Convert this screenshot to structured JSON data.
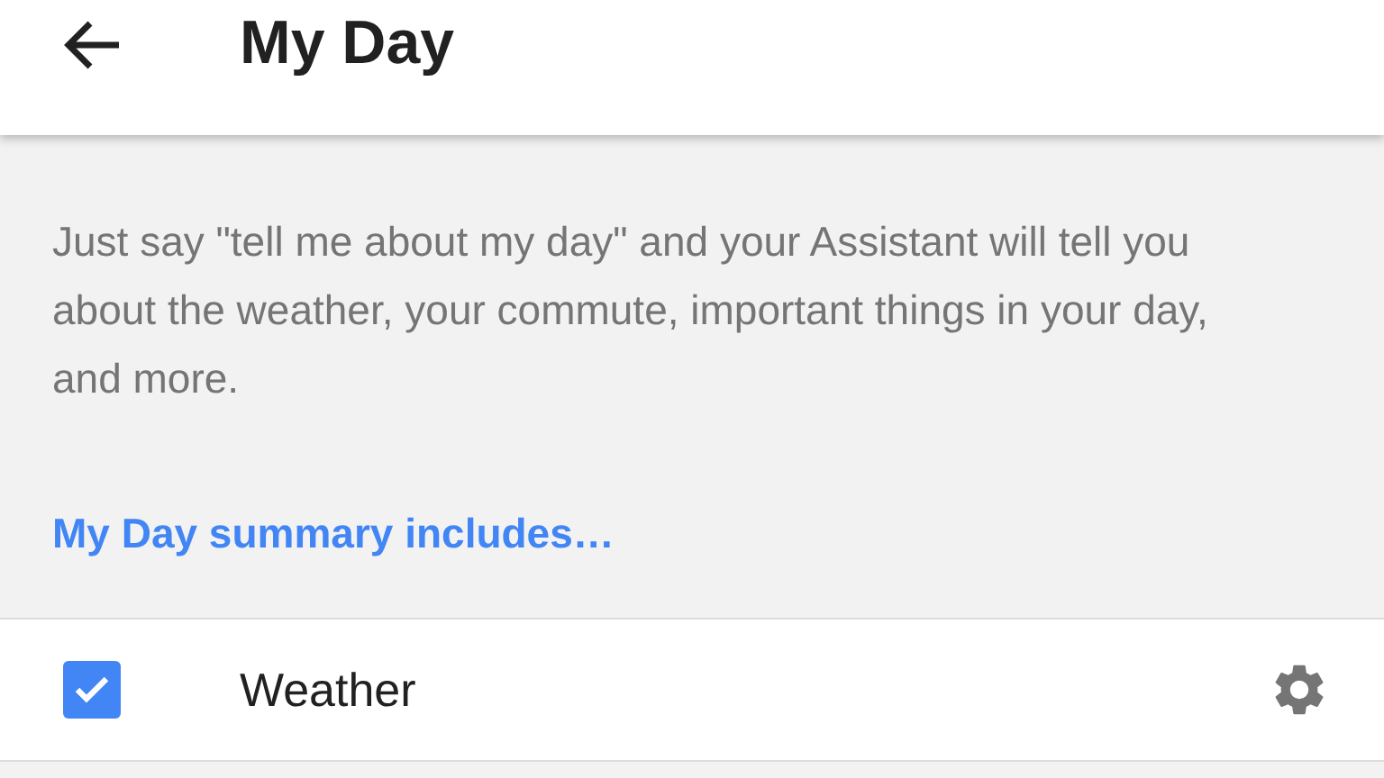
{
  "header": {
    "title": "My Day"
  },
  "description": "Just say \"tell me about my day\" and your Assistant will tell you about the weather, your commute, important things in your day, and more.",
  "section_link": "My Day summary includes…",
  "items": [
    {
      "label": "Weather",
      "checked": true
    }
  ]
}
